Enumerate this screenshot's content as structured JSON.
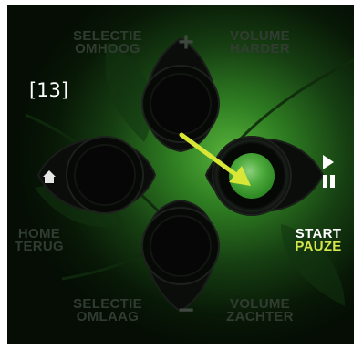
{
  "step_label": "[13]",
  "captions": {
    "selectie_omhoog": [
      "SELECTIE",
      "OMHOOG"
    ],
    "volume_harder": [
      "VOLUME",
      "HARDER"
    ],
    "home_terug": [
      "HOME",
      "TERUG"
    ],
    "start_pauze": [
      "START",
      "PAUZE"
    ],
    "selectie_omlaag": [
      "SELECTIE",
      "OMLAAG"
    ],
    "volume_zachter": [
      "VOLUME",
      "ZACHTER"
    ]
  },
  "signs": {
    "plus": "+",
    "minus": "−"
  },
  "icons": {
    "home": "home-icon",
    "play_pause": "play-pause-icon",
    "pointer": "pointer-arrow"
  },
  "colors": {
    "highlight_green": "#4eab3c",
    "arrow_yellow": "#d7e637",
    "caption_dim": "#313c31",
    "caption_active_top": "#ffffff",
    "caption_active_bottom": "#d6e64e"
  }
}
